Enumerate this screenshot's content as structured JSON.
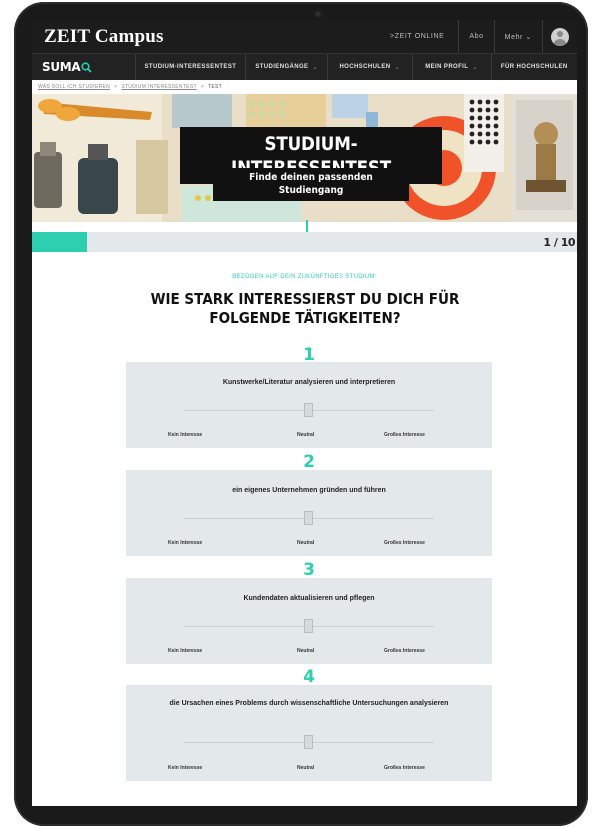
{
  "header": {
    "brand": "ZEIT Campus",
    "links": [
      ">ZEIT ONLINE",
      "Abo",
      "Mehr ⌄"
    ]
  },
  "nav": {
    "logo": "SUMA",
    "items": [
      {
        "label": "STUDIUM-INTERESSENTEST",
        "caret": ""
      },
      {
        "label": "STUDIENGÄNGE",
        "caret": "⌄"
      },
      {
        "label": "HOCHSCHULEN",
        "caret": "⌄"
      },
      {
        "label": "MEIN PROFIL",
        "caret": "⌄"
      },
      {
        "label": "FÜR HOCHSCHULEN",
        "caret": ""
      }
    ]
  },
  "breadcrumb": {
    "items": [
      "WAS SOLL ICH STUDIEREN",
      "STUDIUM INTERESSENTEST"
    ],
    "separator": ">",
    "current": "TEST"
  },
  "hero": {
    "title": "STUDIUM-INTERESSENTEST",
    "subtitle": "Finde deinen passenden Studiengang"
  },
  "progress": {
    "value": 0.1,
    "counter": "1 / 10"
  },
  "questionnaire": {
    "kicker": "BEZOGEN AUF DEIN ZUKÜNFTIGES STUDIUM:",
    "question": "WIE STARK INTERESSIERST DU DICH FÜR FOLGENDE TÄTIGKEITEN?",
    "scale_labels": {
      "low": "Kein Interesse",
      "mid": "Neutral",
      "high": "Großes Interesse"
    },
    "items": [
      {
        "number": "1",
        "text": "Kunstwerke/Literatur analysieren und interpretieren",
        "slider_value": 0.5
      },
      {
        "number": "2",
        "text": "ein eigenes Unternehmen gründen und führen",
        "slider_value": 0.5
      },
      {
        "number": "3",
        "text": "Kundendaten aktualisieren und pflegen",
        "slider_value": 0.5
      },
      {
        "number": "4",
        "text": "die Ursachen eines Problems durch wissenschaftliche Untersuchungen analysieren",
        "slider_value": 0.5
      }
    ]
  },
  "colors": {
    "accent": "#2ecfaf",
    "topbar": "#1c1c1c",
    "panel": "#e3e9eb"
  }
}
